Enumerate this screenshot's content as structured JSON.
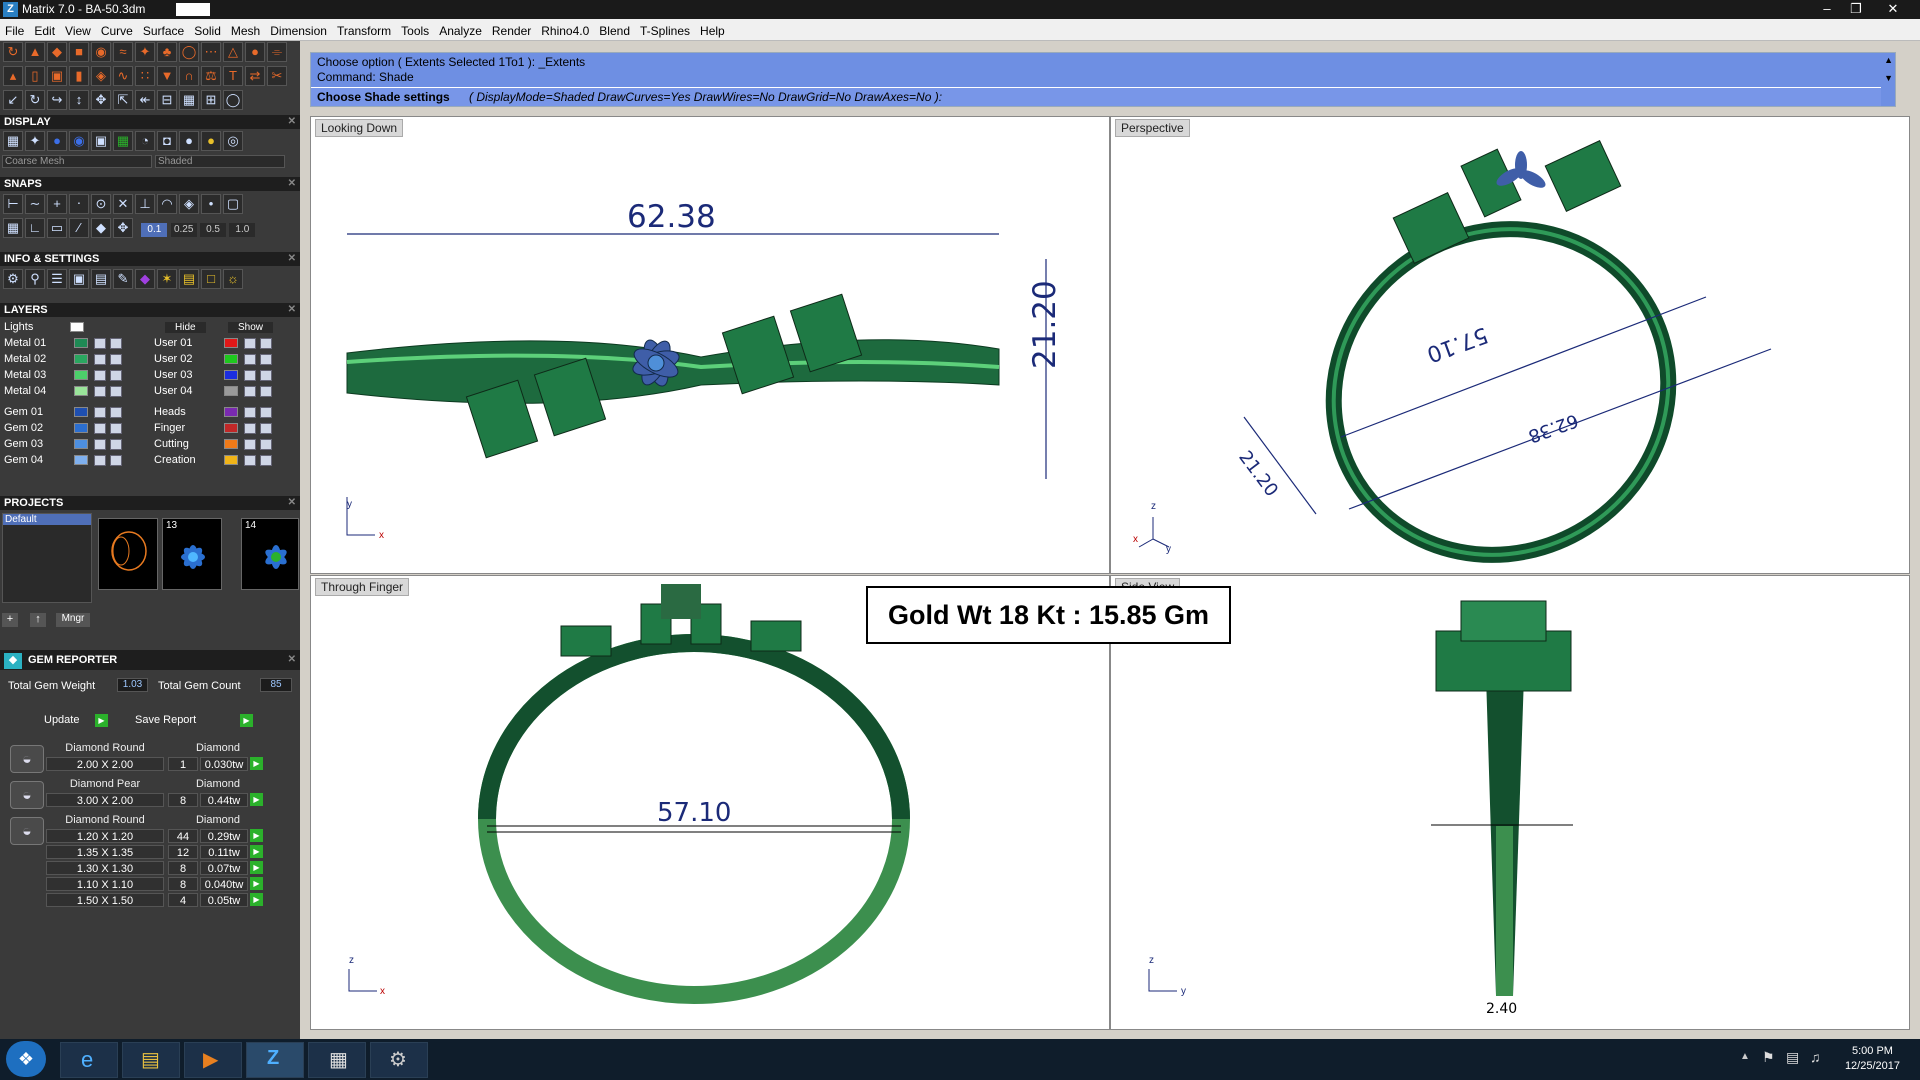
{
  "window": {
    "title": "Matrix 7.0 - BA-50.3dm"
  },
  "menu": [
    "File",
    "Edit",
    "View",
    "Curve",
    "Surface",
    "Solid",
    "Mesh",
    "Dimension",
    "Transform",
    "Tools",
    "Analyze",
    "Render",
    "Rhino4.0",
    "Blend",
    "T-Splines",
    "Help"
  ],
  "command": {
    "line1": "Choose option ( Extents  Selected  1To1 ): _Extents",
    "line2": "Command: Shade",
    "prompt_label": "Choose Shade settings",
    "prompt_opts": "( DisplayMode=Shaded  DrawCurves=Yes  DrawWires=No  DrawGrid=No  DrawAxes=No ):"
  },
  "panels": {
    "display": "DISPLAY",
    "display_mesh": "Coarse Mesh",
    "display_mode": "Shaded",
    "snaps": "SNAPS",
    "snap_values": [
      "0.1",
      "0.25",
      "0.5",
      "1.0"
    ],
    "info": "INFO & SETTINGS",
    "layers": "LAYERS",
    "lights": "Lights",
    "hide": "Hide",
    "show": "Show",
    "projects": "PROJECTS",
    "project_default": "Default",
    "project_nums": [
      "13",
      "14"
    ],
    "mngr": "Mngr",
    "gem_reporter": "GEM REPORTER",
    "total_gem_weight_label": "Total Gem Weight",
    "total_gem_weight": "1.03",
    "total_gem_count_label": "Total Gem Count",
    "total_gem_count": "85",
    "update": "Update",
    "save_report": "Save Report"
  },
  "layers_left": [
    {
      "name": "Metal 01",
      "color": "#1f8a55"
    },
    {
      "name": "Metal 02",
      "color": "#2aa760"
    },
    {
      "name": "Metal 03",
      "color": "#4ccf6a"
    },
    {
      "name": "Metal 04",
      "color": "#9ae49a"
    },
    {
      "name": "Gem 01",
      "color": "#1f4fb0"
    },
    {
      "name": "Gem 02",
      "color": "#2c6fd0"
    },
    {
      "name": "Gem 03",
      "color": "#4d8fe0"
    },
    {
      "name": "Gem 04",
      "color": "#7fb0ee"
    }
  ],
  "layers_right": [
    {
      "name": "User 01",
      "color": "#e01818"
    },
    {
      "name": "User 02",
      "color": "#1ec81e"
    },
    {
      "name": "User 03",
      "color": "#1c2ee0"
    },
    {
      "name": "User 04",
      "color": "#9a9a9a"
    },
    {
      "name": "Heads",
      "color": "#7a2ab0"
    },
    {
      "name": "Finger",
      "color": "#c02828"
    },
    {
      "name": "Cutting",
      "color": "#f07a18"
    },
    {
      "name": "Creation",
      "color": "#f0b418"
    }
  ],
  "gems": [
    {
      "name": "Diamond Round",
      "type": "Diamond",
      "rows": [
        {
          "size": "2.00 X 2.00",
          "qty": "1",
          "wt": "0.030tw"
        }
      ]
    },
    {
      "name": "Diamond Pear",
      "type": "Diamond",
      "rows": [
        {
          "size": "3.00 X 2.00",
          "qty": "8",
          "wt": "0.44tw"
        }
      ]
    },
    {
      "name": "Diamond Round",
      "type": "Diamond",
      "rows": [
        {
          "size": "1.20 X 1.20",
          "qty": "44",
          "wt": "0.29tw"
        },
        {
          "size": "1.35 X 1.35",
          "qty": "12",
          "wt": "0.11tw"
        },
        {
          "size": "1.30 X 1.30",
          "qty": "8",
          "wt": "0.07tw"
        },
        {
          "size": "1.10 X 1.10",
          "qty": "8",
          "wt": "0.040tw"
        },
        {
          "size": "1.50 X 1.50",
          "qty": "4",
          "wt": "0.05tw"
        }
      ]
    }
  ],
  "viewports": {
    "top": {
      "label": "Looking Down",
      "dim_width": "62.38",
      "dim_height": "21.20"
    },
    "persp": {
      "label": "Perspective",
      "dim_a": "57.10",
      "dim_b": "62.38",
      "dim_c": "21.20"
    },
    "front": {
      "label": "Through Finger",
      "dim": "57.10"
    },
    "side": {
      "label": "Side View",
      "dim": "2.40"
    }
  },
  "gold_weight": "Gold Wt 18 Kt : 15.85 Gm",
  "clock": {
    "time": "5:00 PM",
    "date": "12/25/2017"
  }
}
